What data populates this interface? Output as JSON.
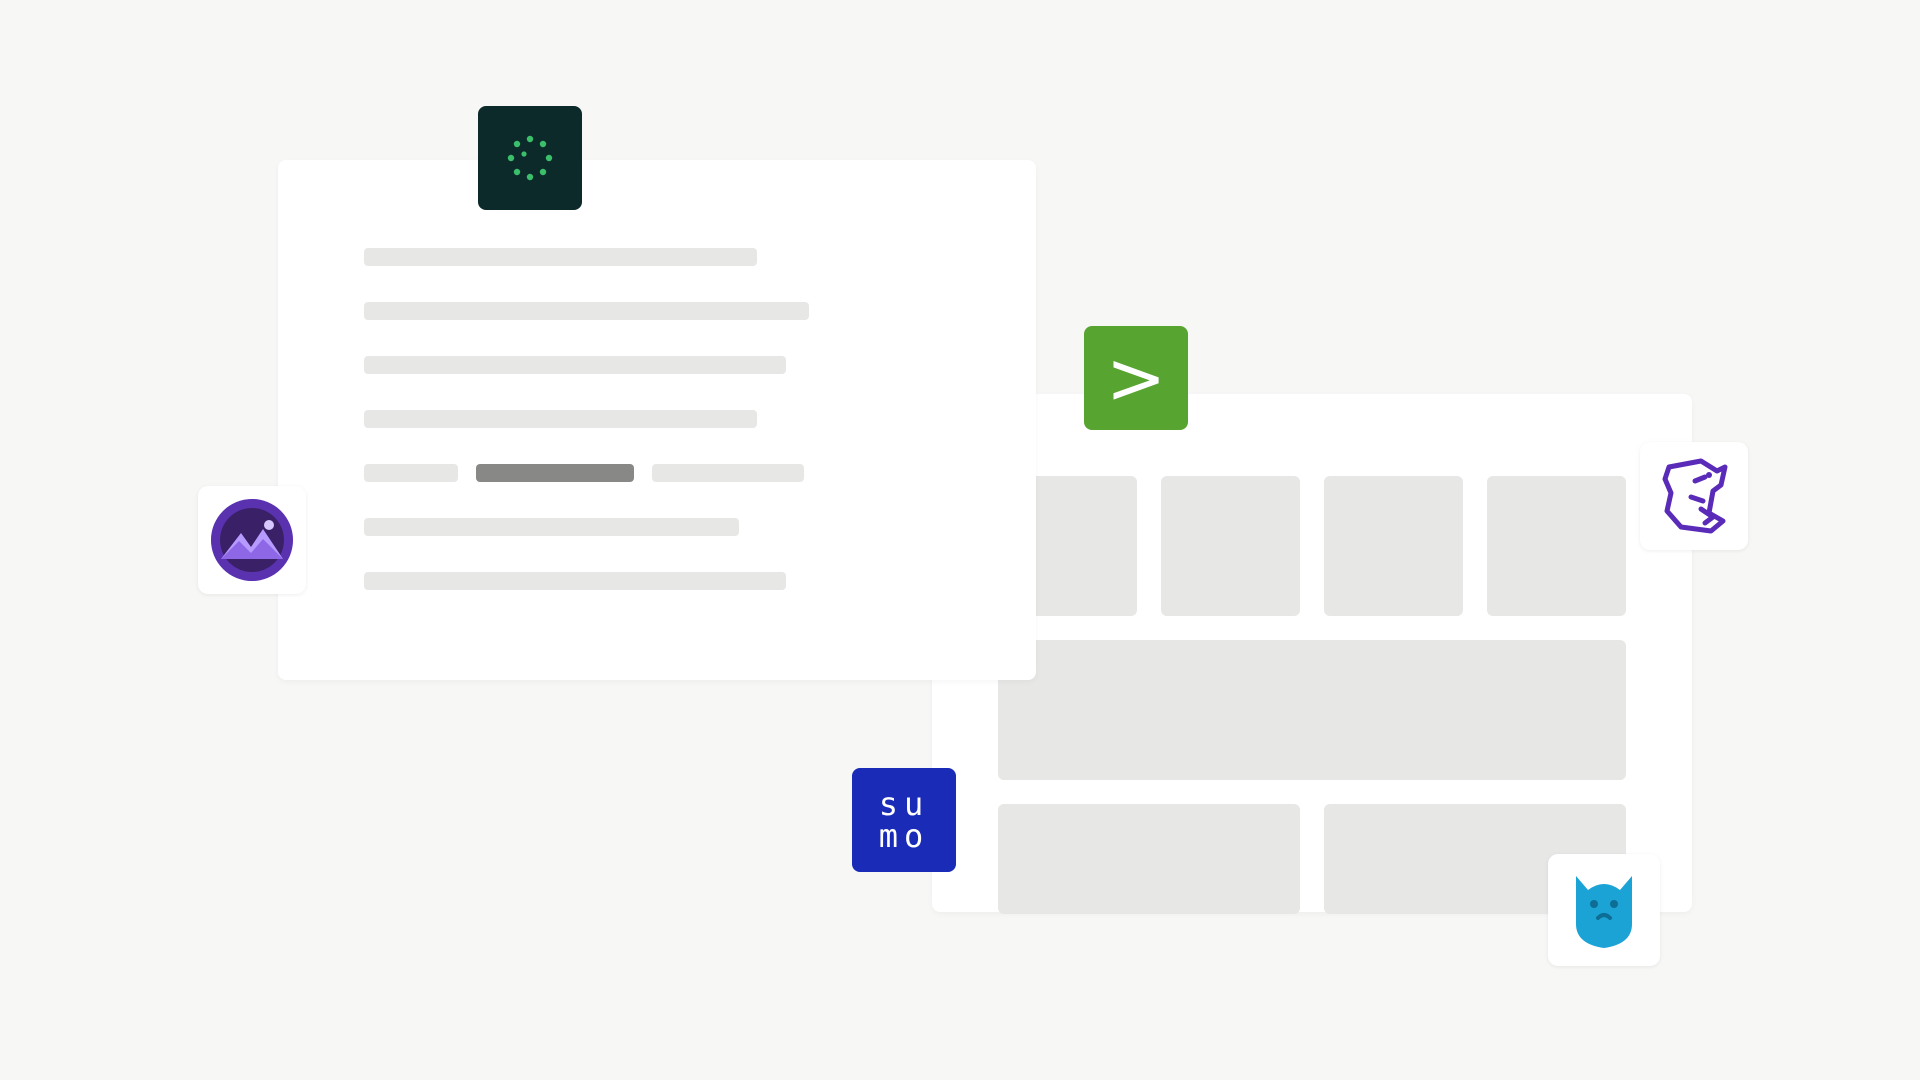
{
  "doc": {
    "line_widths_pct": [
      67,
      76,
      72,
      67,
      64,
      72
    ],
    "highlight_row": {
      "seg1_pct": 16,
      "seg2_pct": 27,
      "seg3_pct": 26
    }
  },
  "dashboard": {
    "row_top_tiles": 4,
    "row_mid_tiles": 1,
    "row_bot_tiles": 2
  },
  "icons": {
    "dots": "dots-ring-icon",
    "purple": "purple-mountain-icon",
    "green_arrow_glyph": ">",
    "sumo_line1": "su",
    "sumo_line2": "mo",
    "dog": "dog-outline-icon",
    "blue": "blue-cat-icon"
  },
  "colors": {
    "bg": "#f7f7f6",
    "card": "#ffffff",
    "placeholder": "#e7e7e6",
    "placeholder_dark": "#888886",
    "dots_bg": "#0d2a2a",
    "dots_fg": "#3bbf6b",
    "green_badge": "#58a430",
    "sumo_bg": "#1a2bb8",
    "dog_stroke": "#5a2bb8",
    "blue_cat": "#1ba3d6"
  }
}
